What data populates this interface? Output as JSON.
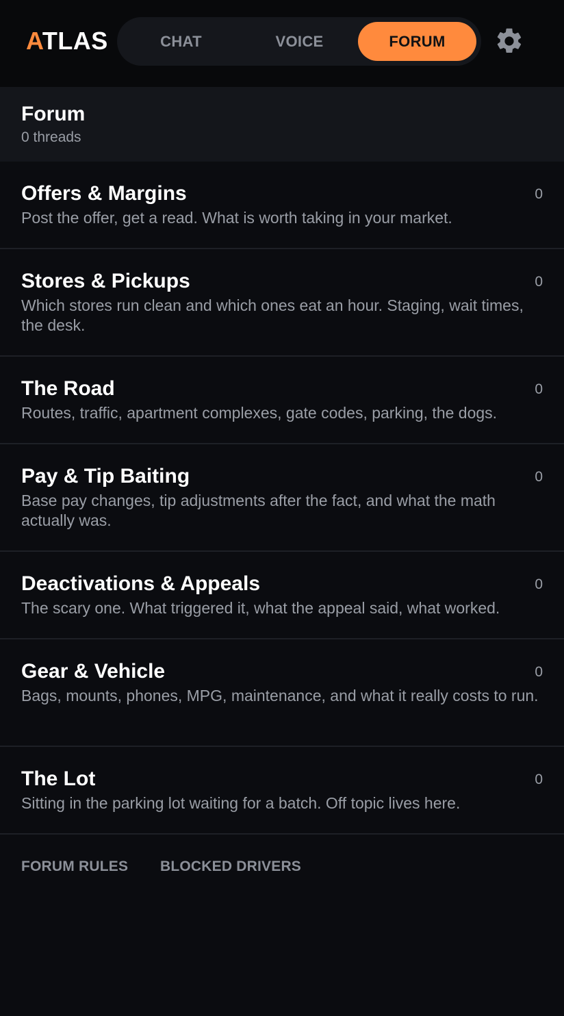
{
  "header": {
    "logo_accent": "A",
    "logo_rest": "TLAS",
    "tabs": [
      {
        "label": "CHAT",
        "active": false
      },
      {
        "label": "VOICE",
        "active": false
      },
      {
        "label": "FORUM",
        "active": true
      }
    ],
    "settings_icon": "gear-icon",
    "accent_color": "#ff8a3d"
  },
  "forum": {
    "title": "Forum",
    "thread_count_text": "0 threads",
    "categories": [
      {
        "name": "Offers & Margins",
        "description": "Post the offer, get a read. What is worth taking in your market.",
        "count": "0"
      },
      {
        "name": "Stores & Pickups",
        "description": "Which stores run clean and which ones eat an hour. Staging, wait times, the desk.",
        "count": "0"
      },
      {
        "name": "The Road",
        "description": "Routes, traffic, apartment complexes, gate codes, parking, the dogs.",
        "count": "0"
      },
      {
        "name": "Pay & Tip Baiting",
        "description": "Base pay changes, tip adjustments after the fact, and what the math actually was.",
        "count": "0"
      },
      {
        "name": "Deactivations & Appeals",
        "description": "The scary one. What triggered it, what the appeal said, what worked.",
        "count": "0"
      },
      {
        "name": "Gear & Vehicle",
        "description": "Bags, mounts, phones, MPG, maintenance, and what it really costs to run.",
        "count": "0"
      },
      {
        "name": "The Lot",
        "description": "Sitting in the parking lot waiting for a batch. Off topic lives here.",
        "count": "0"
      }
    ]
  },
  "footer": {
    "rules_label": "FORUM RULES",
    "blocked_label": "BLOCKED DRIVERS"
  }
}
